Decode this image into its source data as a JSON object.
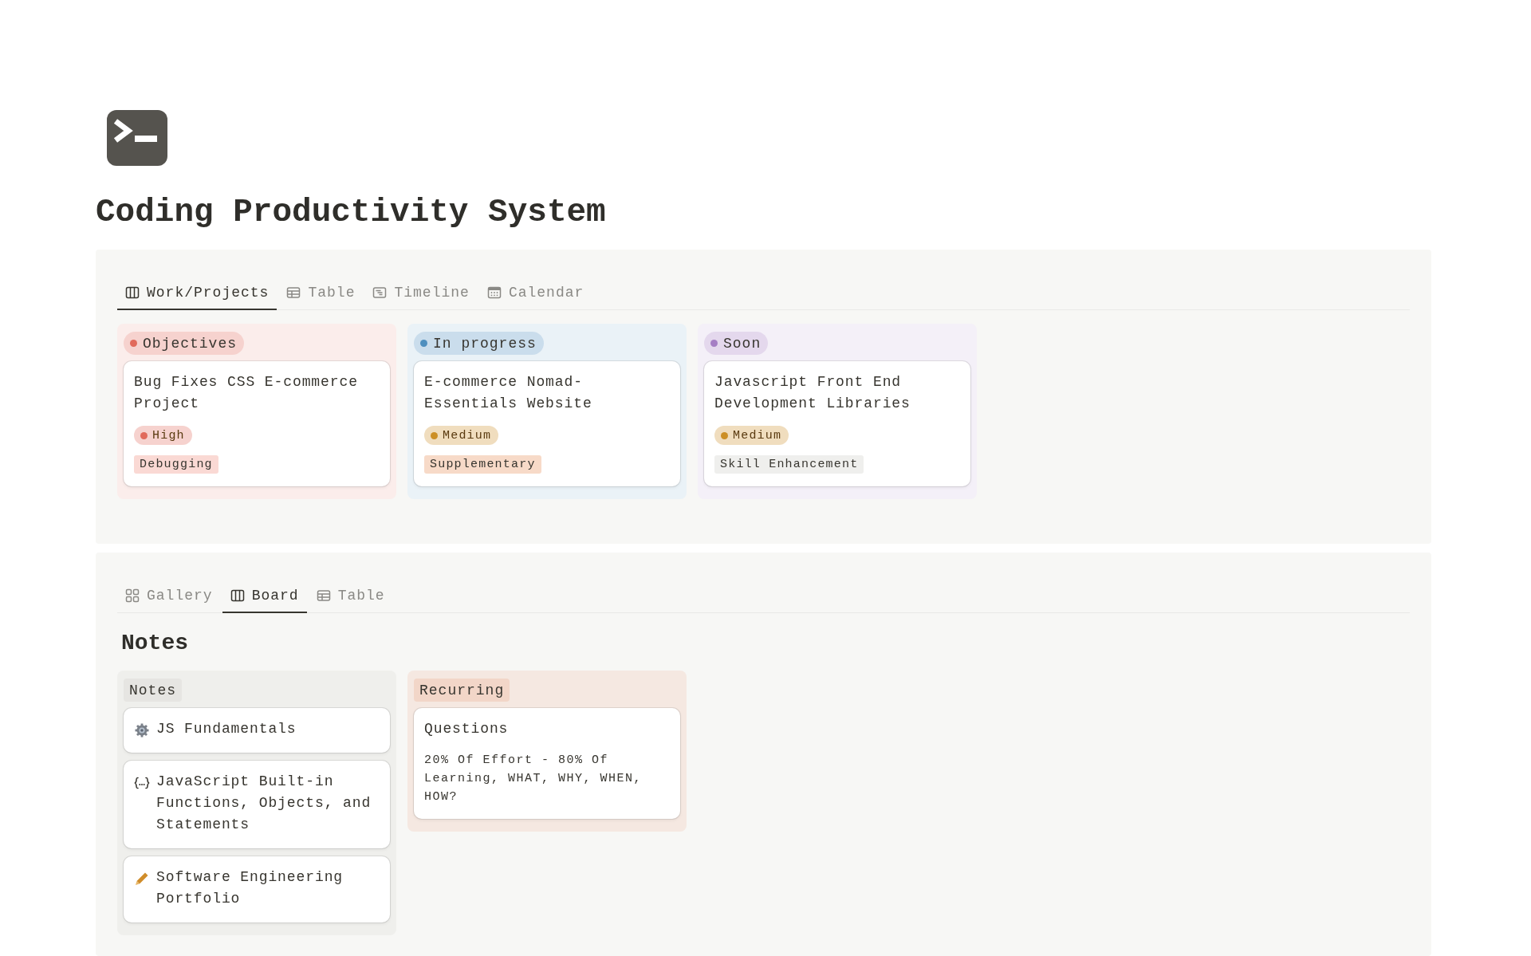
{
  "title": "Coding Productivity System",
  "projects": {
    "tabs": [
      {
        "label": "Work/Projects",
        "kind": "board",
        "selected": true
      },
      {
        "label": "Table",
        "kind": "table",
        "selected": false
      },
      {
        "label": "Timeline",
        "kind": "timeline",
        "selected": false
      },
      {
        "label": "Calendar",
        "kind": "calendar",
        "selected": false
      }
    ],
    "columns": [
      {
        "label": "Objectives",
        "color": "#e16a5b",
        "cards": [
          {
            "title": "Bug Fixes CSS E-commerce Project",
            "priority": {
              "label": "High",
              "color": "#e16a5b"
            },
            "tag": {
              "label": "Debugging",
              "color": "#fad9d4"
            }
          }
        ]
      },
      {
        "label": "In progress",
        "color": "#4f8fbe",
        "cards": [
          {
            "title": "E-commerce Nomad-Essentials Website",
            "priority": {
              "label": "Medium",
              "color": "#cc8f26"
            },
            "tag": {
              "label": "Supplementary",
              "color": "#f7dac8"
            }
          }
        ]
      },
      {
        "label": "Soon",
        "color": "#a57ec4",
        "cards": [
          {
            "title": "Javascript Front End Development Libraries",
            "priority": {
              "label": "Medium",
              "color": "#cc8f26"
            },
            "tag": {
              "label": "Skill Enhancement",
              "color": "#efefed"
            }
          }
        ]
      }
    ]
  },
  "notes": {
    "tabs": [
      {
        "label": "Gallery",
        "kind": "gallery",
        "selected": false
      },
      {
        "label": "Board",
        "kind": "board",
        "selected": true
      },
      {
        "label": "Table",
        "kind": "table",
        "selected": false
      }
    ],
    "heading": "Notes",
    "columns": [
      {
        "label": "Notes",
        "color": "#e6e5e2",
        "cards": [
          {
            "kind": "gear",
            "title": "JS Fundamentals"
          },
          {
            "kind": "braces",
            "title": "JavaScript Built-in Functions, Objects, and Statements"
          },
          {
            "kind": "pencil",
            "title": "Software Engineering Portfolio"
          }
        ]
      },
      {
        "label": "Recurring",
        "color": "#f2d6c8",
        "cards": [
          {
            "kind": "text",
            "title": "Questions",
            "description": "20% Of Effort - 80% Of Learning, WHAT, WHY, WHEN, HOW?"
          }
        ]
      }
    ]
  }
}
